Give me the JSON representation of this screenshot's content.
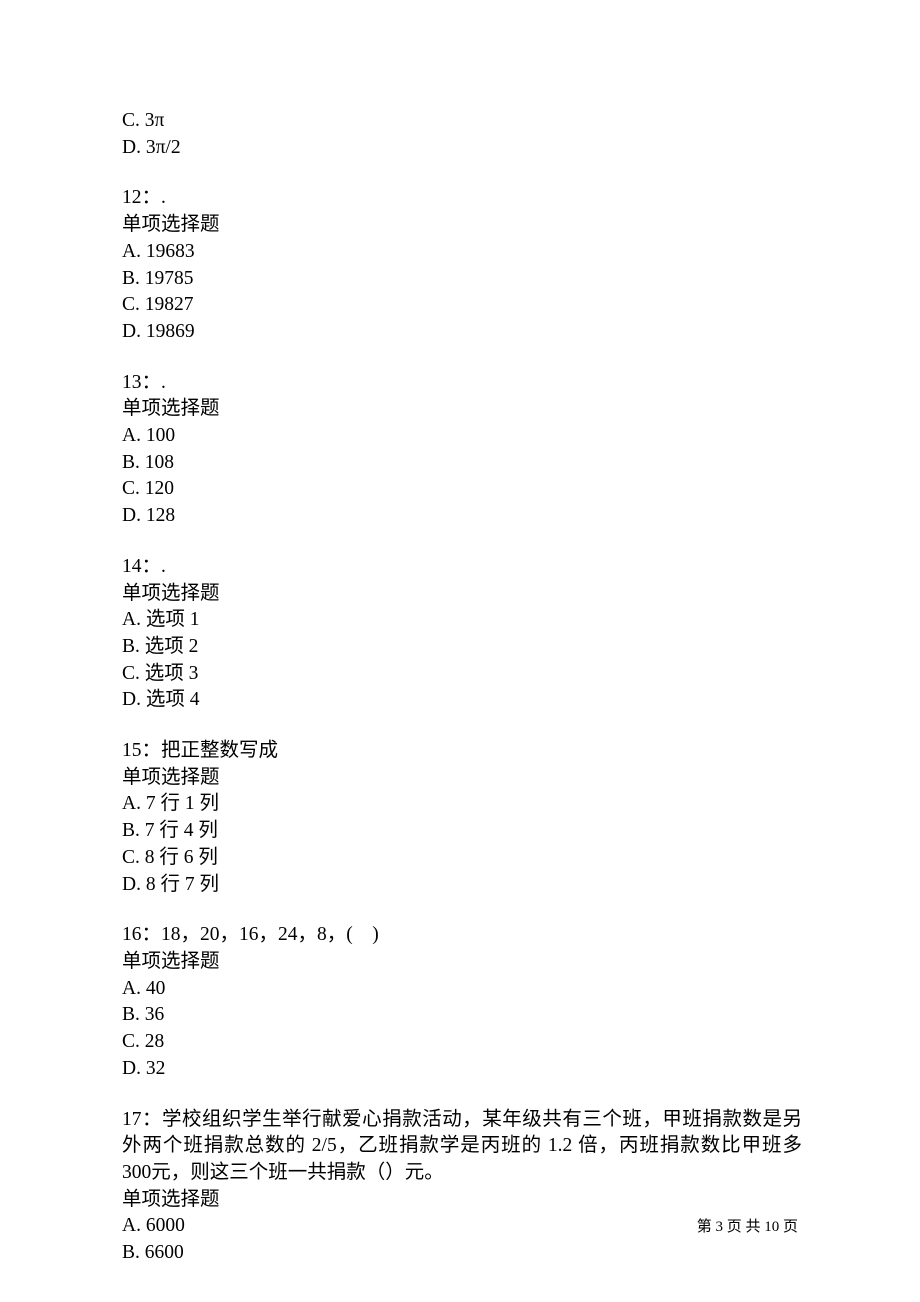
{
  "q11_tail": {
    "options": {
      "C": "C. 3π",
      "D": "D. 3π/2"
    }
  },
  "q12": {
    "header": "12：.",
    "type": "单项选择题",
    "options": {
      "A": "A. 19683",
      "B": "B. 19785",
      "C": "C. 19827",
      "D": "D. 19869"
    }
  },
  "q13": {
    "header": "13：.",
    "type": "单项选择题",
    "options": {
      "A": "A. 100",
      "B": "B. 108",
      "C": "C. 120",
      "D": "D. 128"
    }
  },
  "q14": {
    "header": "14：.",
    "type": "单项选择题",
    "options": {
      "A": "A. 选项 1",
      "B": "B. 选项 2",
      "C": "C. 选项 3",
      "D": "D. 选项 4"
    }
  },
  "q15": {
    "header": "15：把正整数写成",
    "type": "单项选择题",
    "options": {
      "A": "A. 7 行 1 列",
      "B": "B. 7 行 4 列",
      "C": "C. 8 行 6 列",
      "D": "D. 8 行 7 列"
    }
  },
  "q16": {
    "header": "16：18，20，16，24，8，(　)",
    "type": "单项选择题",
    "options": {
      "A": "A. 40",
      "B": "B. 36",
      "C": "C. 28",
      "D": "D. 32"
    }
  },
  "q17": {
    "header": "17：学校组织学生举行献爱心捐款活动，某年级共有三个班，甲班捐款数是另外两个班捐款总数的 2/5，乙班捐款学是丙班的 1.2 倍，丙班捐款数比甲班多 300元，则这三个班一共捐款（）元。",
    "type": "单项选择题",
    "options": {
      "A": "A. 6000",
      "B": "B. 6600"
    }
  },
  "footer": {
    "text": "第 3 页 共 10 页"
  }
}
